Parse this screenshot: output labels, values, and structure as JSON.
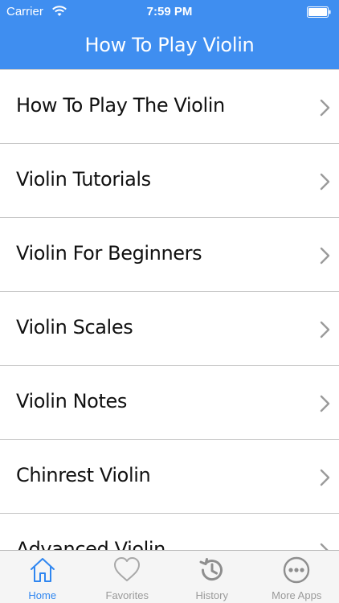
{
  "status_bar": {
    "carrier": "Carrier",
    "time": "7:59 PM"
  },
  "nav": {
    "title": "How To Play Violin"
  },
  "list": {
    "items": [
      {
        "label": "How To Play The Violin"
      },
      {
        "label": "Violin Tutorials"
      },
      {
        "label": "Violin For Beginners"
      },
      {
        "label": "Violin Scales"
      },
      {
        "label": "Violin Notes"
      },
      {
        "label": "Chinrest Violin"
      },
      {
        "label": "Advanced Violin"
      }
    ]
  },
  "tabbar": {
    "tabs": [
      {
        "label": "Home",
        "icon": "home-icon",
        "active": true
      },
      {
        "label": "Favorites",
        "icon": "heart-icon",
        "active": false
      },
      {
        "label": "History",
        "icon": "history-icon",
        "active": false
      },
      {
        "label": "More Apps",
        "icon": "more-icon",
        "active": false
      }
    ]
  },
  "colors": {
    "accent": "#3f8ef0",
    "active_tab": "#2f86f0",
    "inactive_tab": "#9a9a9a"
  }
}
